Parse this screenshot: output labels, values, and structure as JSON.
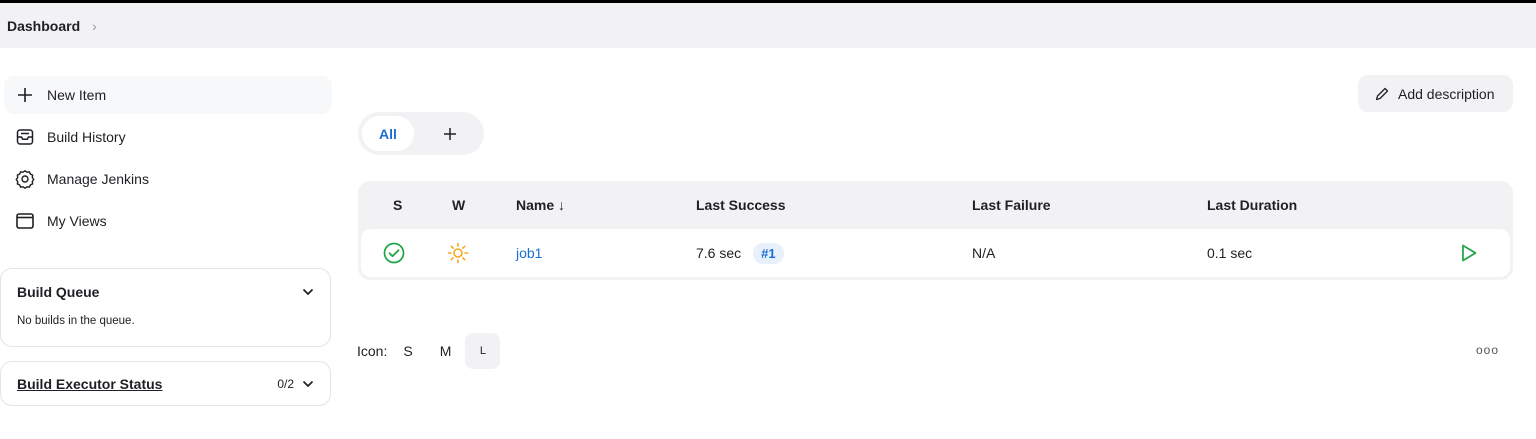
{
  "breadcrumb": {
    "items": [
      "Dashboard"
    ],
    "separator": "›"
  },
  "sidebar": {
    "items": [
      {
        "label": "New Item",
        "icon": "plus-icon"
      },
      {
        "label": "Build History",
        "icon": "inbox-icon"
      },
      {
        "label": "Manage Jenkins",
        "icon": "gear-icon"
      },
      {
        "label": "My Views",
        "icon": "window-icon"
      }
    ]
  },
  "build_queue": {
    "title": "Build Queue",
    "empty_text": "No builds in the queue."
  },
  "executor_status": {
    "title": "Build Executor Status",
    "count": "0/2"
  },
  "header": {
    "add_description": "Add description"
  },
  "tabs": {
    "all": "All",
    "add": "+"
  },
  "table": {
    "headers": {
      "status": "S",
      "weather": "W",
      "name": "Name ↓",
      "last_success": "Last Success",
      "last_failure": "Last Failure",
      "last_duration": "Last Duration"
    },
    "rows": [
      {
        "status": "success",
        "weather": "sunny",
        "name": "job1",
        "last_success": "7.6 sec",
        "build": "#1",
        "last_failure": "N/A",
        "last_duration": "0.1 sec"
      }
    ]
  },
  "icon_size": {
    "label": "Icon:",
    "options": [
      "S",
      "M",
      "L"
    ],
    "selected": "L"
  },
  "more": "ooo",
  "colors": {
    "accent": "#1a6fd3",
    "success": "#1ea446",
    "weather": "#f5a623",
    "surface": "#f2f2f5"
  }
}
